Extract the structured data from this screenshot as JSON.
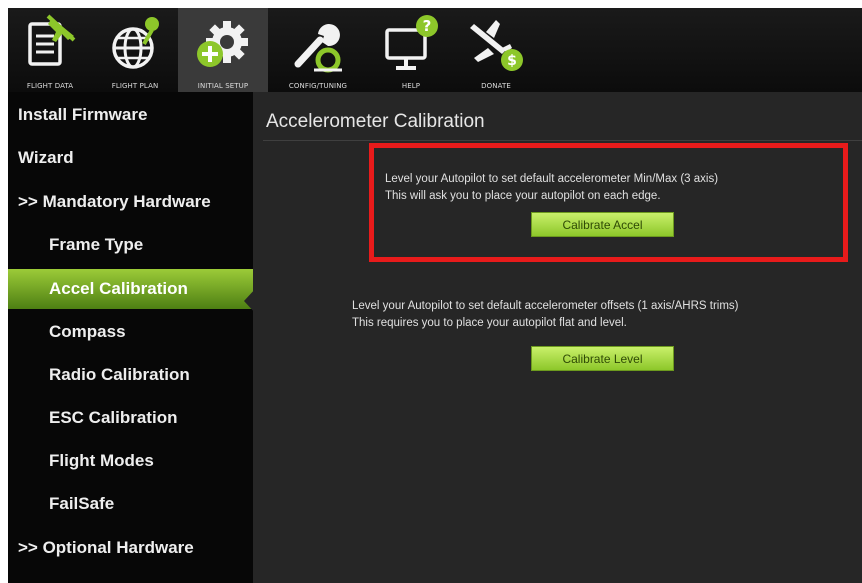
{
  "toolbar": {
    "buttons": [
      {
        "label": "FLIGHT DATA",
        "icon": "flight-data-icon"
      },
      {
        "label": "FLIGHT PLAN",
        "icon": "flight-plan-icon"
      },
      {
        "label": "INITIAL SETUP",
        "icon": "initial-setup-icon"
      },
      {
        "label": "CONFIG/TUNING",
        "icon": "config-tuning-icon"
      },
      {
        "label": "HELP",
        "icon": "help-icon"
      },
      {
        "label": "DONATE",
        "icon": "donate-icon"
      }
    ],
    "active_button": "INITIAL SETUP"
  },
  "sidebar": {
    "items": [
      {
        "label": "Install Firmware"
      },
      {
        "label": "Wizard"
      },
      {
        "label": ">> Mandatory Hardware"
      },
      {
        "label": "Frame Type"
      },
      {
        "label": "Accel Calibration"
      },
      {
        "label": "Compass"
      },
      {
        "label": "Radio Calibration"
      },
      {
        "label": "ESC Calibration"
      },
      {
        "label": "Flight Modes"
      },
      {
        "label": "FailSafe"
      },
      {
        "label": ">> Optional Hardware"
      }
    ],
    "active_item": "Accel Calibration"
  },
  "main": {
    "title": "Accelerometer Calibration",
    "accel": {
      "line1": "Level your Autopilot to set default accelerometer Min/Max (3 axis)",
      "line2": "This will ask you to place your autopilot on each edge.",
      "button": "Calibrate Accel"
    },
    "level": {
      "line1": "Level your Autopilot to set default accelerometer offsets (1 axis/AHRS trims)",
      "line2": "This requires you to place your autopilot flat and level.",
      "button": "Calibrate Level"
    }
  },
  "colors": {
    "accent_green": "#8dc72a",
    "highlight_red": "#e81b1b",
    "sidebar_bg": "#070707",
    "panel_bg": "#262626"
  }
}
